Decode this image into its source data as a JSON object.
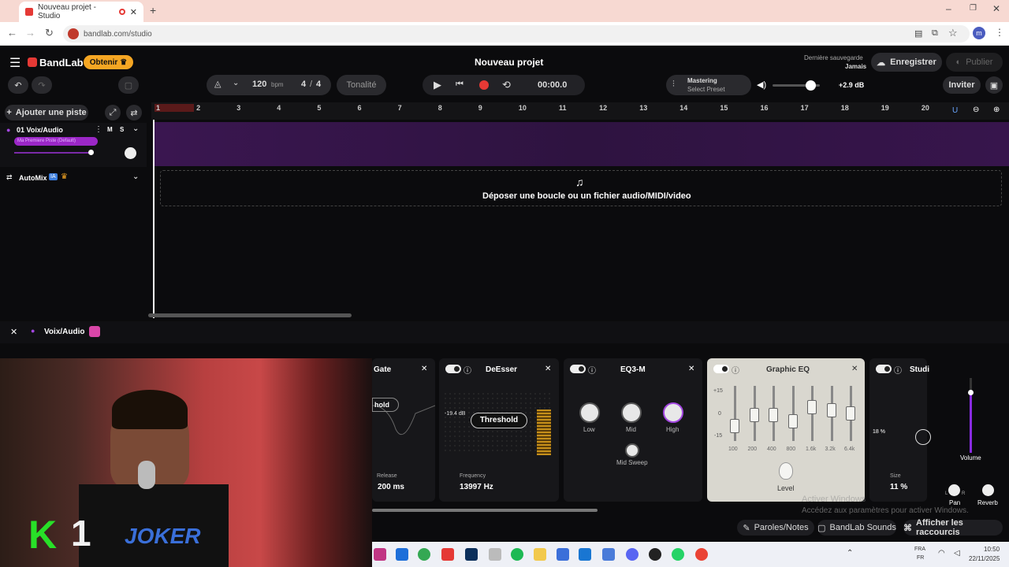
{
  "browser": {
    "tab_title": "Nouveau projet - Studio",
    "url": "bandlab.com/studio",
    "profile_initial": "m"
  },
  "header": {
    "logo": "BandLab",
    "get_button": "Obtenir",
    "project_title": "Nouveau projet",
    "last_save_label": "Dernière sauvegarde",
    "last_save_value": "Jamais",
    "save_button": "Enregistrer",
    "publish_button": "Publier",
    "invite_button": "Inviter"
  },
  "transport": {
    "tempo": "120",
    "tempo_unit": "bpm",
    "signature_num": "4",
    "signature_sep": "/",
    "signature_den": "4",
    "key_button": "Tonalité",
    "time": "00:00.0",
    "mastering_title": "Mastering",
    "mastering_preset": "Select Preset",
    "master_gain": "+2.9 dB"
  },
  "tracks": {
    "add_track": "Ajouter une piste",
    "track1_name": "01  Voix/Audio",
    "track1_mute": "M",
    "track1_solo": "S",
    "track1_chain": "Ma Premiere Piste (Default)",
    "automix_label": "AutoMix",
    "automix_badge": "IA",
    "dropzone": "Déposer une boucle ou un fichier audio/MIDI/video"
  },
  "ruler": [
    "1",
    "2",
    "3",
    "4",
    "5",
    "6",
    "7",
    "8",
    "9",
    "10",
    "11",
    "12",
    "13",
    "14",
    "15",
    "16",
    "17",
    "18",
    "19",
    "20"
  ],
  "fx": {
    "track_name": "Voix/Audio",
    "gate": {
      "title": "Gate",
      "param": "hold",
      "release_label": "Release",
      "release_value": "200 ms"
    },
    "deesser": {
      "title": "DeEsser",
      "threshold": "Threshold",
      "db": "-19.4 dB",
      "freq_label": "Frequency",
      "freq_value": "13997 Hz"
    },
    "eq3": {
      "title": "EQ3-M",
      "low": "Low",
      "mid": "Mid",
      "high": "High",
      "sweep": "Mid Sweep"
    },
    "geq": {
      "title": "Graphic EQ",
      "scale": [
        "+15",
        "0",
        "-15"
      ],
      "bands": [
        "100",
        "200",
        "400",
        "800",
        "1.6k",
        "3.2k",
        "6.4k"
      ],
      "level": "Level"
    },
    "studio": {
      "title": "Studi",
      "percent": "18 %",
      "size_label": "Size",
      "size_value": "11 %"
    },
    "volume": "Volume",
    "pan": "Pan",
    "pan_l": "L",
    "pan_r": "R",
    "reverb": "Reverb"
  },
  "footer": {
    "lyrics": "Paroles/Notes",
    "sounds": "BandLab Sounds",
    "shortcuts": "Afficher les raccourcis",
    "activation_line1": "Activer Windows",
    "activation_line2": "Accédez aux paramètres pour activer Windows."
  },
  "taskbar": {
    "lang1": "FRA",
    "lang2": "FR",
    "time": "10:50",
    "date": "22/11/2025"
  },
  "overlay": {
    "text_k": "K",
    "text_1": "1",
    "text_joker": "JOKER"
  },
  "colors": {
    "accent_purple": "#8a2be2",
    "record_red": "#e53935",
    "brand_orange": "#f5a623"
  }
}
